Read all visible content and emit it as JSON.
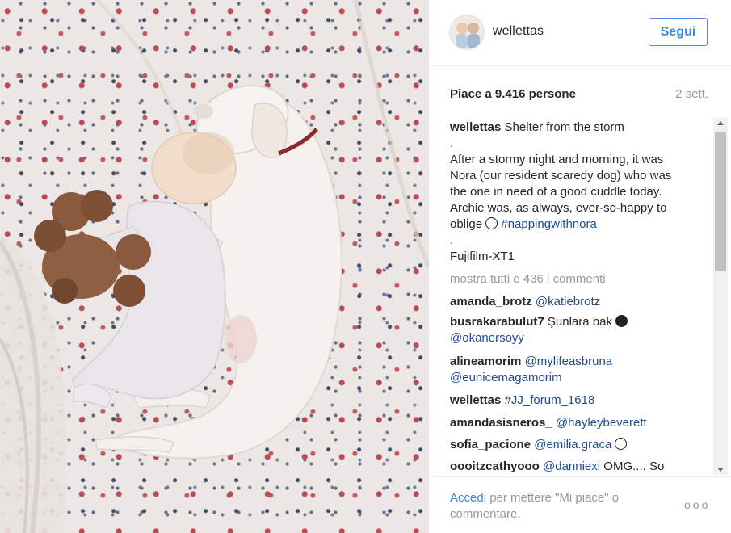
{
  "header": {
    "username": "wellettas",
    "follow_label": "Segui"
  },
  "post": {
    "likes_text": "Piace a 9.416 persone",
    "time_text": "2 sett."
  },
  "caption": {
    "username": "wellettas",
    "lines": [
      "Shelter from the storm",
      ".",
      "After a stormy night and morning, it was",
      "Nora (our resident scaredy dog) who was",
      "the one in need of a good cuddle today.",
      "Archie was, as always, ever-so-happy to",
      "oblige"
    ],
    "hashtag": "#nappingwithnora",
    "dot": ".",
    "camera": "Fujifilm-XT1"
  },
  "show_all": "mostra tutti e 436 i commenti",
  "comments": [
    {
      "user": "amanda_brotz",
      "text": "@katiebrotz"
    },
    {
      "user": "busrakarabulut7",
      "text": "Şunlara bak",
      "mention2": "@okanersoyy"
    },
    {
      "user": "alineamorim",
      "text": "@mylifeasbruna",
      "mention2": "@eunicemagamorim"
    },
    {
      "user": "wellettas",
      "text": "#JJ_forum_1618"
    },
    {
      "user": "amandasisneros_",
      "text": "@hayleybeverett"
    },
    {
      "user": "sofia_pacione",
      "text": "@emilia.graca"
    },
    {
      "user": "oooitzcathyooo",
      "text": "@danniexi",
      "rest": "OMG.... So"
    }
  ],
  "footer": {
    "login_label": "Accedi",
    "login_rest": "per mettere \"Mi piace\" o commentare.",
    "more_label": "ooo"
  },
  "icons": {
    "smile": "smiling-face-icon",
    "devil": "devil-face-icon"
  },
  "colors": {
    "link": "#3f8ad6",
    "mention": "#1f4b8f",
    "muted": "#999999"
  }
}
